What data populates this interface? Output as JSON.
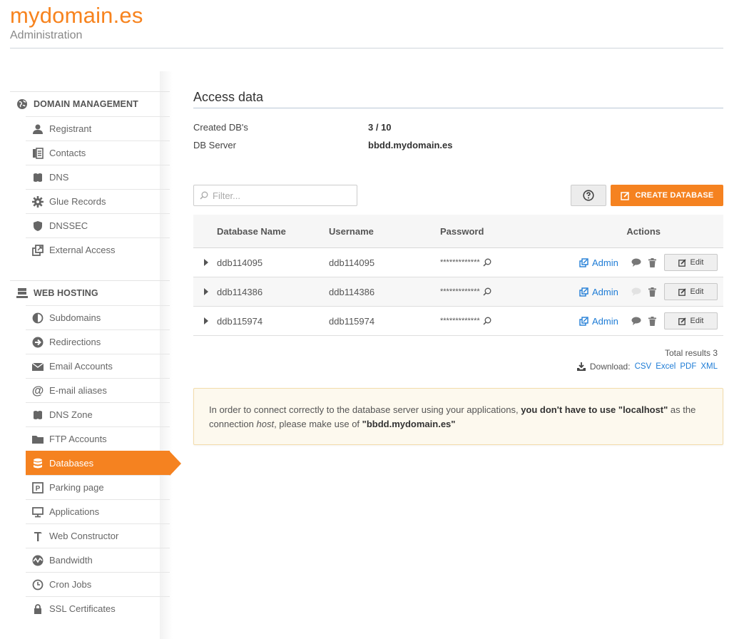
{
  "header": {
    "title": "mydomain.es",
    "subtitle": "Administration"
  },
  "sidebar": {
    "domain_management": {
      "heading": "DOMAIN MANAGEMENT",
      "items": [
        {
          "label": "Registrant",
          "icon": "user-icon"
        },
        {
          "label": "Contacts",
          "icon": "contacts-icon"
        },
        {
          "label": "DNS",
          "icon": "dns-icon"
        },
        {
          "label": "Glue Records",
          "icon": "gear-icon"
        },
        {
          "label": "DNSSEC",
          "icon": "shield-icon"
        },
        {
          "label": "External Access",
          "icon": "external-icon"
        }
      ]
    },
    "web_hosting": {
      "heading": "WEB HOSTING",
      "items": [
        {
          "label": "Subdomains",
          "icon": "half-circle-icon"
        },
        {
          "label": "Redirections",
          "icon": "arrow-circle-icon"
        },
        {
          "label": "Email Accounts",
          "icon": "envelope-icon"
        },
        {
          "label": "E-mail aliases",
          "icon": "at-icon"
        },
        {
          "label": "DNS Zone",
          "icon": "dns-zone-icon"
        },
        {
          "label": "FTP Accounts",
          "icon": "folder-icon"
        },
        {
          "label": "Databases",
          "icon": "database-icon",
          "active": true
        },
        {
          "label": "Parking page",
          "icon": "parking-icon"
        },
        {
          "label": "Applications",
          "icon": "monitor-icon"
        },
        {
          "label": "Web Constructor",
          "icon": "hammer-icon"
        },
        {
          "label": "Bandwidth",
          "icon": "bandwidth-icon"
        },
        {
          "label": "Cron Jobs",
          "icon": "clock-icon"
        },
        {
          "label": "SSL Certificates",
          "icon": "lock-icon"
        }
      ]
    }
  },
  "main": {
    "title": "Access data",
    "created_label": "Created DB's",
    "created_value": "3 / 10",
    "server_label": "DB Server",
    "server_value": "bbdd.mydomain.es",
    "filter_placeholder": "Filter...",
    "create_label": "CREATE DATABASE",
    "columns": {
      "name": "Database Name",
      "user": "Username",
      "password": "Password",
      "actions": "Actions"
    },
    "rows": [
      {
        "name": "ddb114095",
        "user": "ddb114095",
        "password": "*************",
        "admin": "Admin",
        "edit": "Edit"
      },
      {
        "name": "ddb114386",
        "user": "ddb114386",
        "password": "*************",
        "admin": "Admin",
        "edit": "Edit"
      },
      {
        "name": "ddb115974",
        "user": "ddb115974",
        "password": "*************",
        "admin": "Admin",
        "edit": "Edit"
      }
    ],
    "total_results": "Total results 3",
    "download_label": "Download:",
    "formats": [
      "CSV",
      "Excel",
      "PDF",
      "XML"
    ],
    "notice": {
      "part1": "In order to connect correctly to the database server using your applications, ",
      "bold1": "you don't have to use \"localhost\"",
      "part2": " as the connection ",
      "italic": "host",
      "part3": ", please make use of ",
      "bold2": "\"bbdd.mydomain.es\""
    }
  },
  "colors": {
    "accent": "#f58220",
    "link": "#1e7cd6",
    "notice_bg": "#fdf9ee"
  }
}
